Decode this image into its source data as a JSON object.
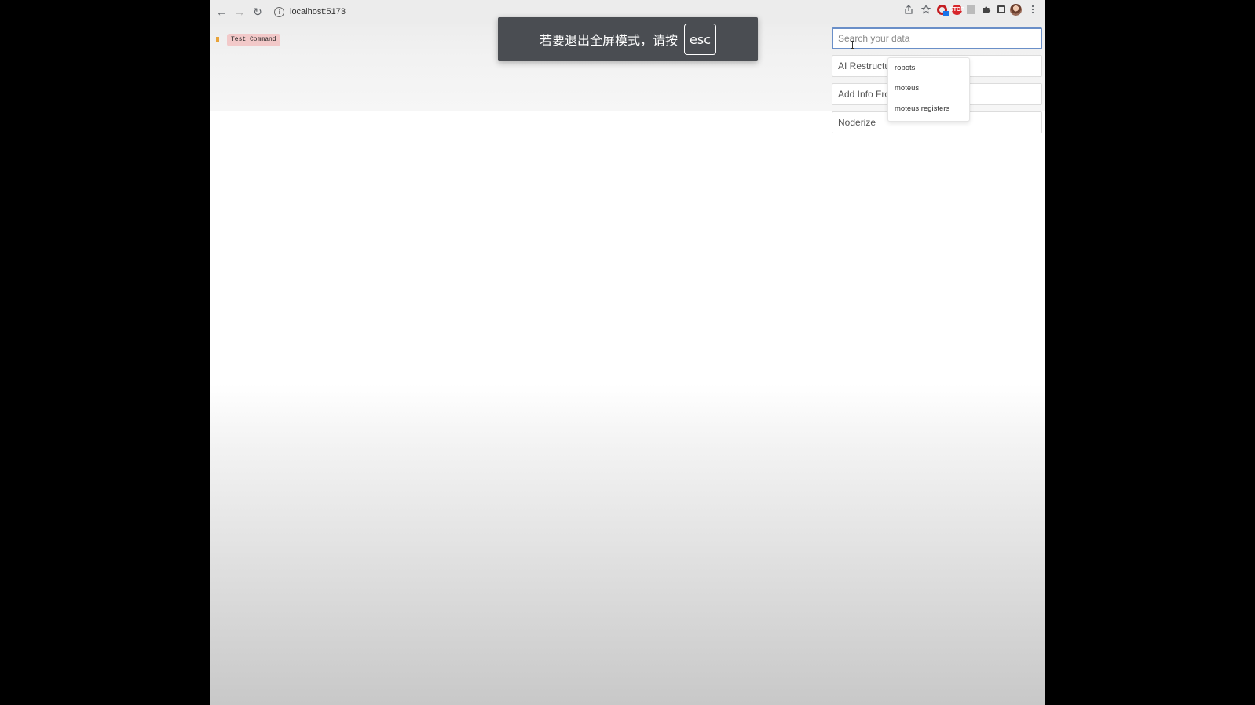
{
  "browser": {
    "url": "localhost:5173",
    "nav": {
      "back_icon": "←",
      "forward_icon": "→",
      "reload_icon": "↻"
    },
    "info_icon": "i",
    "extensions": {
      "stop_label": "STOP"
    }
  },
  "fullscreen_notice": {
    "text": "若要退出全屏模式，请按",
    "key": "esc"
  },
  "test_command": {
    "label": "Test Command"
  },
  "search": {
    "placeholder": "Search your data"
  },
  "commands": [
    {
      "label": "AI Restructure"
    },
    {
      "label": "Add Info From"
    },
    {
      "label": "Noderize"
    }
  ],
  "suggestions": [
    "robots",
    "moteus",
    "moteus registers"
  ],
  "colors": {
    "search_border": "#6a8fc8",
    "test_command_bg": "#f2c9c9",
    "notice_bg": "#4a4d52"
  }
}
